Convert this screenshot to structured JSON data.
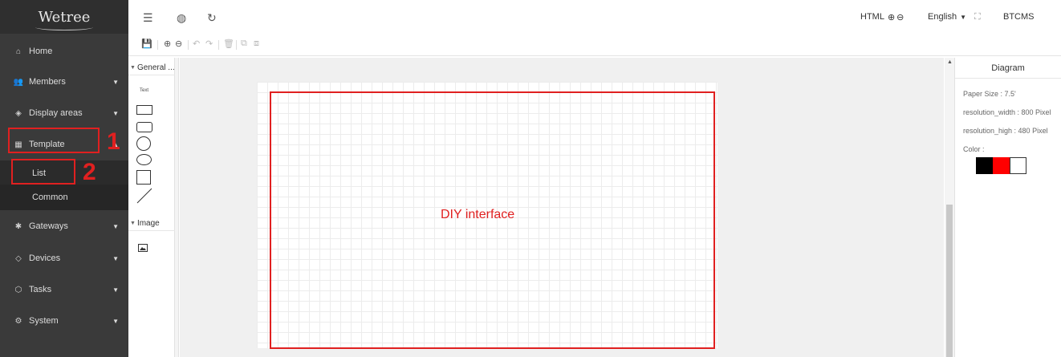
{
  "sidebar": {
    "logo": "Wetree",
    "items": {
      "home": {
        "label": "Home",
        "icon": "home-icon"
      },
      "members": {
        "label": "Members",
        "icon": "members-icon"
      },
      "display_areas": {
        "label": "Display areas",
        "icon": "layers-icon"
      },
      "template": {
        "label": "Template",
        "icon": "template-icon"
      },
      "template_list": {
        "label": "List"
      },
      "template_common": {
        "label": "Common"
      },
      "gateways": {
        "label": "Gateways",
        "icon": "gateway-icon"
      },
      "devices": {
        "label": "Devices",
        "icon": "tag-icon"
      },
      "tasks": {
        "label": "Tasks",
        "icon": "cube-icon"
      },
      "system": {
        "label": "System",
        "icon": "gear-icon"
      }
    },
    "annotations": {
      "step1": "1",
      "step2": "2"
    }
  },
  "topbar": {
    "html_label": "HTML",
    "language": "English",
    "user": "BTCMS"
  },
  "shapes_panel": {
    "general_header": "General ...",
    "text_tool": "Text",
    "image_header": "Image"
  },
  "canvas": {
    "annotation": "DIY interface"
  },
  "props": {
    "title": "Diagram",
    "paper_size": "Paper Size : 7.5'",
    "resolution_width": "resolution_width : 800 Pixel",
    "resolution_high": "resolution_high : 480 Pixel",
    "color_label": "Color :",
    "colors": [
      "#000000",
      "#ff0000",
      "#ffffff"
    ]
  },
  "colors": {
    "sidebar_bg": "#3a3a3a",
    "annotation_red": "#e02020"
  }
}
